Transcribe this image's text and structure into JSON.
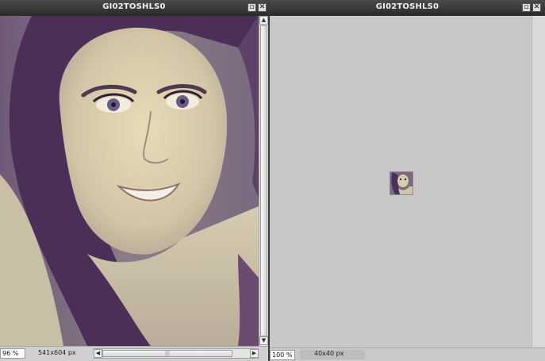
{
  "windows": [
    {
      "title": "GI02TOSHLS0",
      "zoom": "96  %",
      "image_size": "541x604 px"
    },
    {
      "title": "GI02TOSHLS0",
      "zoom": "100  %",
      "image_size": "40x40 px"
    }
  ],
  "icons": {
    "maximize": "window-maximize-icon",
    "close": "window-close-icon"
  },
  "colors": {
    "title_bar": "#2f2f2f",
    "panel": "#c8c8c8",
    "photo_tint": "#7c5f85"
  }
}
